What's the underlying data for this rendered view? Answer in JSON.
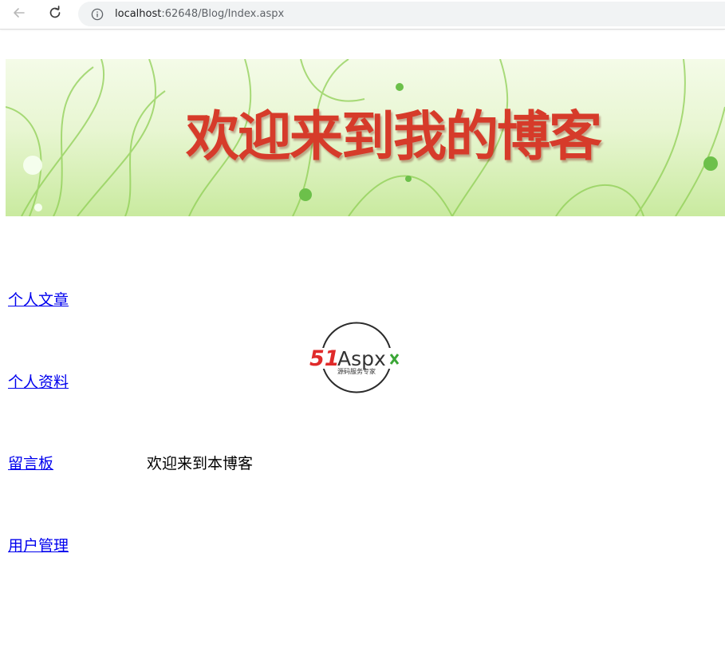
{
  "browser": {
    "url_host": "localhost",
    "url_rest": ":62648/Blog/Index.aspx"
  },
  "banner": {
    "title": "欢迎来到我的博客"
  },
  "nav": {
    "items": [
      {
        "label": "个人文章"
      },
      {
        "label": "个人资料"
      },
      {
        "label": "留言板"
      },
      {
        "label": "用户管理"
      }
    ]
  },
  "logo": {
    "brand_51": "51",
    "brand_aspx": "Aspx",
    "tagline": "源码服务专家"
  },
  "main": {
    "welcome_text": "欢迎来到本博客"
  },
  "colors": {
    "link": "#0000ee",
    "banner_text": "#d63b2a",
    "logo_red": "#e02a2a",
    "logo_green": "#3aa635"
  }
}
